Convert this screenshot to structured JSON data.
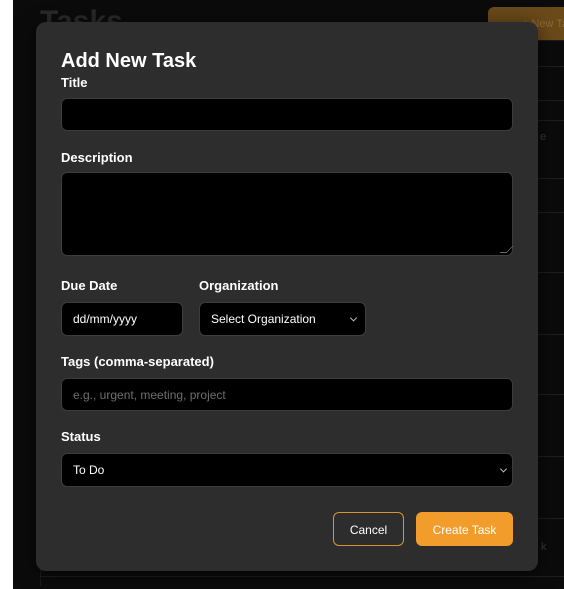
{
  "background": {
    "page_title": "Tasks",
    "new_task_label": "+ New Ta",
    "snippets": [
      "e",
      "k"
    ]
  },
  "modal": {
    "title": "Add New Task",
    "fields": {
      "title_label": "Title",
      "title_value": "",
      "description_label": "Description",
      "description_value": "",
      "due_date_label": "Due Date",
      "due_date_placeholder": "dd/mm/yyyy",
      "organization_label": "Organization",
      "organization_selected": "Select Organization",
      "tags_label": "Tags (comma-separated)",
      "tags_placeholder": "e.g., urgent, meeting, project",
      "status_label": "Status",
      "status_selected": "To Do"
    },
    "buttons": {
      "cancel": "Cancel",
      "create": "Create Task"
    }
  },
  "colors": {
    "modal_bg": "#2d2d2d",
    "input_bg": "#000000",
    "accent": "#f29c2b",
    "text": "#ffffff",
    "placeholder": "#6e6e6e"
  },
  "icons": {
    "select_arrow": "chevron-down-icon",
    "resize": "resize-handle-icon"
  }
}
